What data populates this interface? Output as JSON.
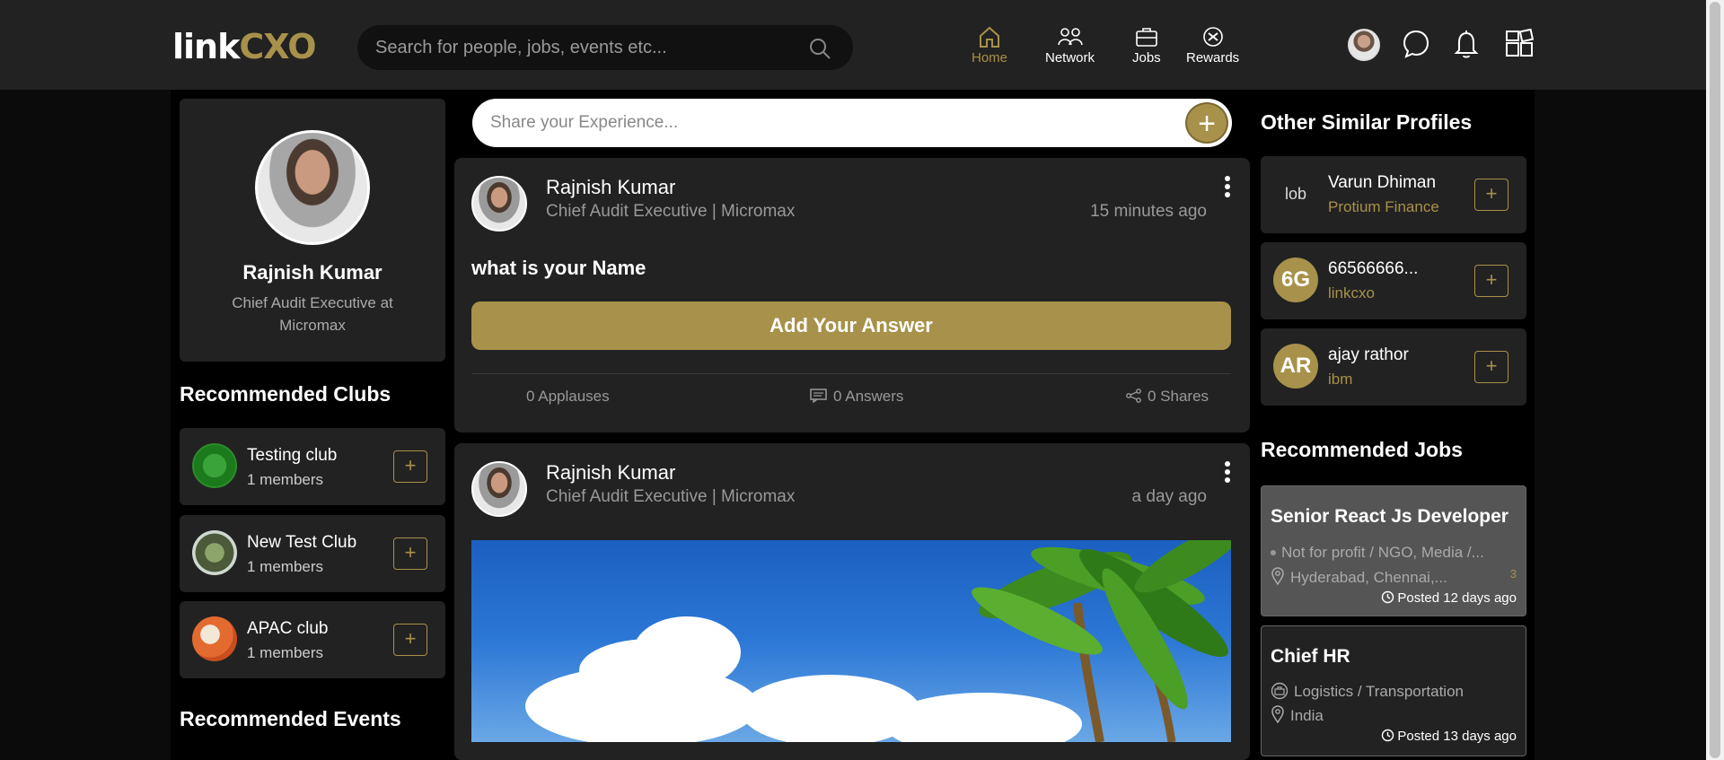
{
  "header": {
    "logo_link": "link",
    "logo_cxo": "CXO",
    "search_placeholder": "Search for people, jobs, events etc...",
    "nav": [
      {
        "label": "Home",
        "icon": "home-icon",
        "active": true
      },
      {
        "label": "Network",
        "icon": "network-icon"
      },
      {
        "label": "Jobs",
        "icon": "briefcase-icon"
      },
      {
        "label": "Rewards",
        "icon": "rewards-icon"
      }
    ]
  },
  "profile": {
    "name": "Rajnish Kumar",
    "title": "Chief Audit Executive at Micromax"
  },
  "clubs": {
    "heading": "Recommended Clubs",
    "items": [
      {
        "name": "Testing club",
        "members": "1 members"
      },
      {
        "name": "New Test Club",
        "members": "1 members"
      },
      {
        "name": "APAC club",
        "members": "1 members"
      }
    ],
    "plus": "+"
  },
  "events": {
    "heading": "Recommended Events"
  },
  "share": {
    "placeholder": "Share your Experience...",
    "plus": "+"
  },
  "posts": [
    {
      "author": "Rajnish Kumar",
      "subtitle": "Chief Audit Executive | Micromax",
      "time": "15 minutes ago",
      "question": "what is your Name",
      "answer_button": "Add Your Answer",
      "applauses": "0 Applauses",
      "answers": "0 Answers",
      "shares": "0 Shares"
    },
    {
      "author": "Rajnish Kumar",
      "subtitle": "Chief Audit Executive | Micromax",
      "time": "a day ago"
    }
  ],
  "similar": {
    "heading": "Other Similar Profiles",
    "items": [
      {
        "name": "Varun Dhiman",
        "company": "Protium Finance",
        "initials": "lob"
      },
      {
        "name": "66566666...",
        "company": "linkcxo",
        "initials": "6G"
      },
      {
        "name": "ajay rathor",
        "company": "ibm",
        "initials": "AR"
      }
    ]
  },
  "jobs": {
    "heading": "Recommended Jobs",
    "items": [
      {
        "title": "Senior React Js Developer",
        "industry": "Not for profit / NGO, Media /...",
        "location": "Hyderabad, Chennai,...",
        "count": "3",
        "posted": "Posted 12 days ago"
      },
      {
        "title": "Chief HR",
        "industry": "Logistics / Transportation",
        "location": "India",
        "posted": "Posted 13 days ago"
      }
    ]
  },
  "colors": {
    "accent": "#a8914a",
    "topbar": "#222222",
    "card": "#222222",
    "background": "#000000"
  }
}
